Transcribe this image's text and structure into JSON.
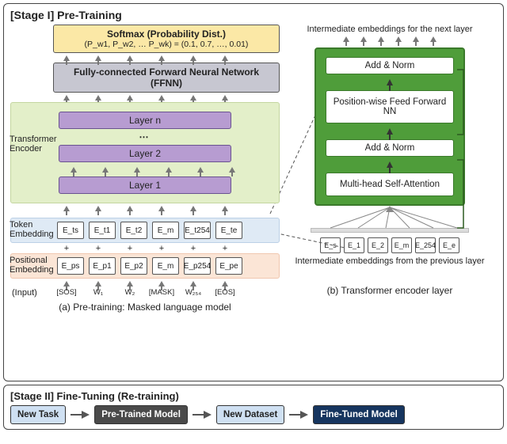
{
  "stage1": {
    "title": "[Stage I] Pre-Training",
    "softmax": {
      "title": "Softmax (Probability Dist.)",
      "sub": "(P_w1, P_w2, … P_wk) = (0.1, 0.7, …, 0.01)"
    },
    "ffnn": "Fully-connected Forward Neural Network (FFNN)",
    "encoder_label": "Transformer Encoder",
    "layers": {
      "top": "Layer n",
      "dots": "⋯",
      "l2": "Layer 2",
      "l1": "Layer 1"
    },
    "token_label": "Token Embedding",
    "pos_label": "Positional Embedding",
    "input_label": "(Input)",
    "token_cells": [
      "E_ts",
      "E_t1",
      "E_t2",
      "E_m",
      "E_t254",
      "E_te"
    ],
    "pos_cells": [
      "E_ps",
      "E_p1",
      "E_p2",
      "E_m",
      "E_p254",
      "E_pe"
    ],
    "input_tokens": [
      "[SOS]",
      "W₁",
      "W₂",
      "[MASK]",
      "W₂₅₄",
      "[EOS]"
    ],
    "plus": "+",
    "caption": "(a) Pre-training: Masked language model"
  },
  "detail": {
    "top": "Intermediate embeddings for the next layer",
    "addnorm": "Add & Norm",
    "ffn": "Position-wise Feed Forward NN",
    "mhsa": "Multi-head Self-Attention",
    "in_cells": [
      "E_s",
      "E_1",
      "E_2",
      "E_m",
      "E_254",
      "E_e"
    ],
    "bottom": "Intermediate embeddings from the previous layer",
    "caption": "(b) Transformer encoder layer"
  },
  "stage2": {
    "title": "[Stage II] Fine-Tuning (Re-training)",
    "newtask": "New Task",
    "pretrained": "Pre-Trained Model",
    "dataset": "New Dataset",
    "finetuned": "Fine-Tuned Model"
  }
}
